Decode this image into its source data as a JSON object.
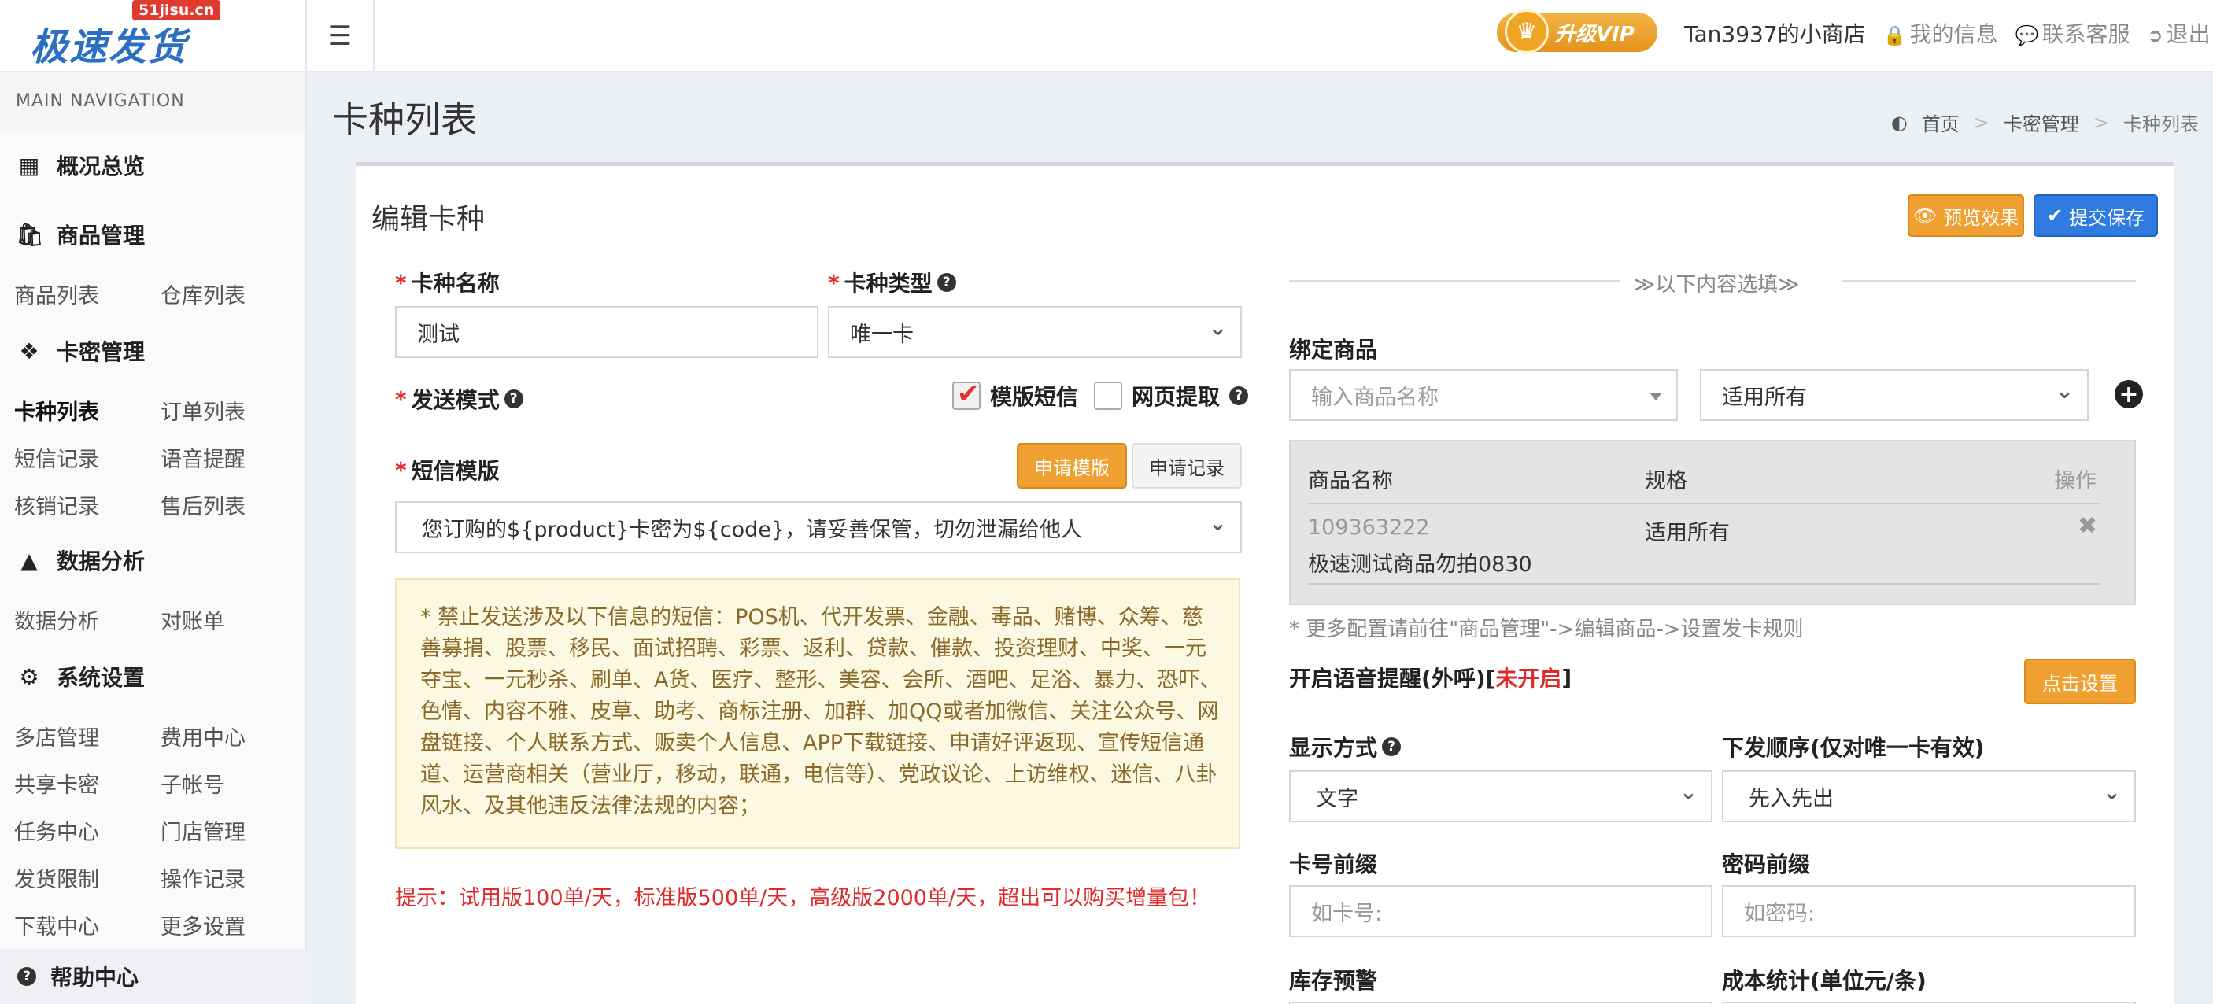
{
  "brand": {
    "name": "极速发货",
    "tag": "51jisu.cn"
  },
  "topbar": {
    "vip": "升级VIP",
    "shop": "Tan3937的小商店",
    "my_info": "我的信息",
    "support": "联系客服",
    "logout": "退出"
  },
  "sidebar": {
    "header": "MAIN NAVIGATION",
    "overview": "概况总览",
    "goods_section": "商品管理",
    "goods_list": "商品列表",
    "warehouse_list": "仓库列表",
    "card_section": "卡密管理",
    "card_types": "卡种列表",
    "order_list": "订单列表",
    "sms_records": "短信记录",
    "voice_alert": "语音提醒",
    "verify_records": "核销记录",
    "after_sales": "售后列表",
    "data_section": "数据分析",
    "data_analysis": "数据分析",
    "reconcile": "对账单",
    "settings_section": "系统设置",
    "multi_store": "多店管理",
    "fee_center": "费用中心",
    "share_cards": "共享卡密",
    "sub_accounts": "子帐号",
    "task_center": "任务中心",
    "store_manage": "门店管理",
    "ship_limit": "发货限制",
    "op_records": "操作记录",
    "download_center": "下载中心",
    "more_settings": "更多设置",
    "help": "帮助中心"
  },
  "page": {
    "title": "卡种列表",
    "breadcrumb": [
      "首页",
      "卡密管理",
      "卡种列表"
    ]
  },
  "form": {
    "title": "编辑卡种",
    "preview_btn": "预览效果",
    "save_btn": "提交保存",
    "card_name_label": "卡种名称",
    "card_name_value": "测试",
    "card_type_label": "卡种类型",
    "card_type_value": "唯一卡",
    "send_mode_label": "发送模式",
    "sms_template_opt": "模版短信",
    "web_fetch_opt": "网页提取",
    "sms_template_label": "短信模版",
    "apply_template_btn": "申请模版",
    "apply_records_btn": "申请记录",
    "sms_template_value": "您订购的${product}卡密为${code}，请妥善保管，切勿泄漏给他人",
    "notice": "* 禁止发送涉及以下信息的短信：POS机、代开发票、金融、毒品、赌博、众筹、慈善募捐、股票、移民、面试招聘、彩票、返利、贷款、催款、投资理财、中奖、一元夺宝、一元秒杀、刷单、A货、医疗、整形、美容、会所、酒吧、足浴、暴力、恐吓、色情、内容不雅、皮草、助考、商标注册、加群、加QQ或者加微信、关注公众号、网盘链接、个人联系方式、贩卖个人信息、APP下载链接、申请好评返现、宣传短信通道、运营商相关（营业厅，移动，联通，电信等）、党政议论、上访维权、迷信、八卦风水、及其他违反法律法规的内容；",
    "tip": "提示：试用版100单/天，标准版500单/天，高级版2000单/天，超出可以购买增量包！"
  },
  "optional": {
    "divider": "≫以下内容选填≫",
    "bind_goods_label": "绑定商品",
    "goods_placeholder": "输入商品名称",
    "spec_value": "适用所有",
    "table_headers": [
      "商品名称",
      "规格",
      "操作"
    ],
    "table_rows": [
      {
        "id": "109363222",
        "name": "极速测试商品勿拍0830",
        "spec": "适用所有"
      }
    ],
    "more_note": "* 更多配置请前往\"商品管理\"->编辑商品->设置发卡规则",
    "voice_label": "开启语音提醒(外呼)[",
    "voice_status": "未开启",
    "voice_close": "]",
    "voice_btn": "点击设置",
    "display_label": "显示方式",
    "display_value": "文字",
    "order_label": "下发顺序(仅对唯一卡有效)",
    "order_value": "先入先出",
    "card_prefix_label": "卡号前缀",
    "card_prefix_placeholder": "如卡号:",
    "pwd_prefix_label": "密码前缀",
    "pwd_prefix_placeholder": "如密码:",
    "stock_alert_label": "库存预警",
    "cost_label": "成本统计(单位元/条)"
  }
}
